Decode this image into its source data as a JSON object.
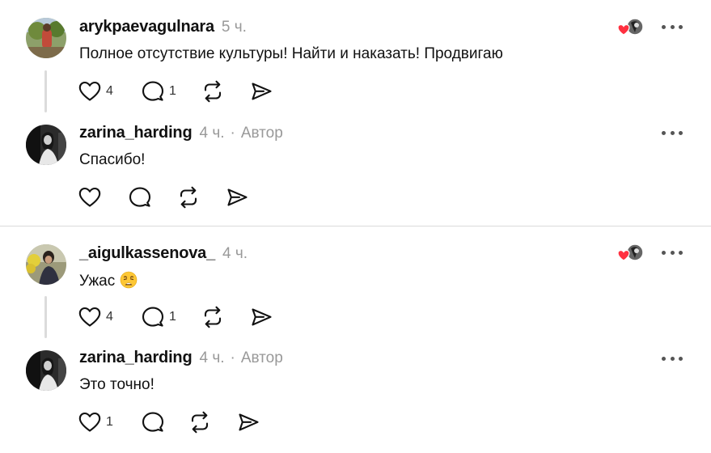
{
  "threads": [
    {
      "post": {
        "username": "arykpaevagulnara",
        "time": "5 ч.",
        "text": "Полное отсутствие культуры! Найти и наказать! Продвигаю",
        "likes": "4",
        "replies": "1"
      },
      "reply": {
        "username": "zarina_harding",
        "time": "4 ч.",
        "separator": "·",
        "author_label": "Автор",
        "text": "Спасибо!"
      }
    },
    {
      "post": {
        "username": "_aigulkassenova_",
        "time": "4 ч.",
        "text": "Ужас",
        "emoji": "weary-face",
        "likes": "4",
        "replies": "1"
      },
      "reply": {
        "username": "zarina_harding",
        "time": "4 ч.",
        "separator": "·",
        "author_label": "Автор",
        "text": "Это точно!",
        "likes": "1"
      }
    }
  ],
  "icons": {
    "like": "heart-icon",
    "comment": "comment-icon",
    "repost": "repost-icon",
    "share": "share-icon",
    "more": "more-options-icon"
  },
  "colors": {
    "separator": "#dbdbdb",
    "muted_text": "#999999",
    "like_heart": "#ff3040"
  }
}
